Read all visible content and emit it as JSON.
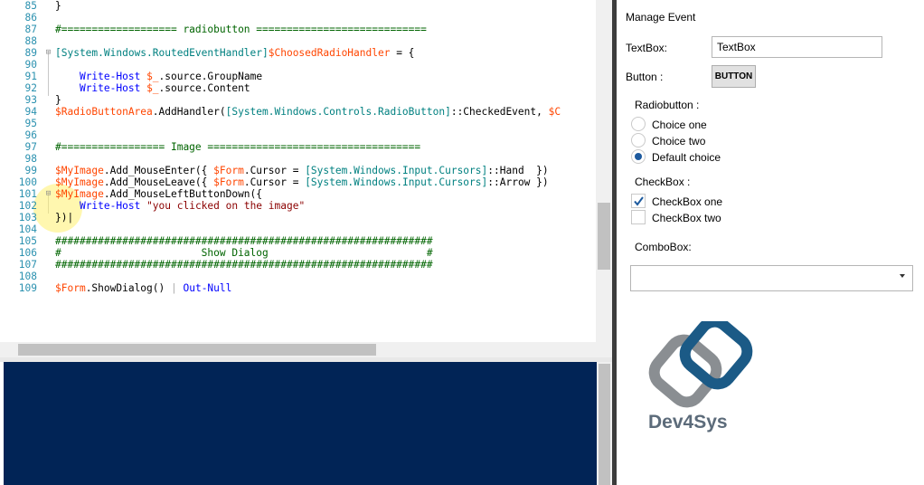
{
  "editor": {
    "lines": [
      {
        "n": "85",
        "parts": [
          [
            "}",
            ""
          ]
        ]
      },
      {
        "n": "86",
        "parts": []
      },
      {
        "n": "87",
        "parts": [
          [
            "#=================== radiobutton ============================",
            "c-cm"
          ]
        ]
      },
      {
        "n": "88",
        "parts": []
      },
      {
        "n": "89",
        "fold": "⊟",
        "parts": [
          [
            "[System.Windows.RoutedEventHandler]",
            "c-type"
          ],
          [
            "$ChoosedRadioHandler",
            "c-var"
          ],
          [
            " = {",
            ""
          ]
        ]
      },
      {
        "n": "90",
        "parts": []
      },
      {
        "n": "91",
        "parts": [
          [
            "    ",
            ""
          ],
          [
            "Write-Host",
            "c-cmd"
          ],
          [
            " ",
            ""
          ],
          [
            "$_",
            "c-var"
          ],
          [
            ".source.GroupName",
            ""
          ]
        ]
      },
      {
        "n": "92",
        "parts": [
          [
            "    ",
            ""
          ],
          [
            "Write-Host",
            "c-cmd"
          ],
          [
            " ",
            ""
          ],
          [
            "$_",
            "c-var"
          ],
          [
            ".source.Content",
            ""
          ]
        ]
      },
      {
        "n": "93",
        "parts": [
          [
            "}",
            ""
          ]
        ]
      },
      {
        "n": "94",
        "parts": [
          [
            "$RadioButtonArea",
            "c-var"
          ],
          [
            ".AddHandler(",
            ""
          ],
          [
            "[System.Windows.Controls.RadioButton]",
            "c-type"
          ],
          [
            "::CheckedEvent, ",
            ""
          ],
          [
            "$C",
            "c-var"
          ]
        ]
      },
      {
        "n": "95",
        "parts": []
      },
      {
        "n": "96",
        "parts": []
      },
      {
        "n": "97",
        "parts": [
          [
            "#================= Image ===================================",
            "c-cm"
          ]
        ]
      },
      {
        "n": "98",
        "parts": []
      },
      {
        "n": "99",
        "parts": [
          [
            "$MyImage",
            "c-var"
          ],
          [
            ".Add_MouseEnter({ ",
            ""
          ],
          [
            "$Form",
            "c-var"
          ],
          [
            ".Cursor = ",
            ""
          ],
          [
            "[System.Windows.Input.Cursors]",
            "c-type"
          ],
          [
            "::Hand  })",
            ""
          ]
        ]
      },
      {
        "n": "100",
        "parts": [
          [
            "$MyImage",
            "c-var"
          ],
          [
            ".Add_MouseLeave({ ",
            ""
          ],
          [
            "$Form",
            "c-var"
          ],
          [
            ".Cursor = ",
            ""
          ],
          [
            "[System.Windows.Input.Cursors]",
            "c-type"
          ],
          [
            "::Arrow })",
            ""
          ]
        ]
      },
      {
        "n": "101",
        "fold": "⊟",
        "parts": [
          [
            "$MyImage",
            "c-var"
          ],
          [
            ".Add_MouseLeftButtonDown({",
            ""
          ]
        ]
      },
      {
        "n": "102",
        "parts": [
          [
            "    ",
            ""
          ],
          [
            "Write-Host",
            "c-cmd"
          ],
          [
            " ",
            ""
          ],
          [
            "\"you clicked on the image\"",
            "c-str"
          ]
        ]
      },
      {
        "n": "103",
        "parts": [
          [
            "})|",
            ""
          ]
        ]
      },
      {
        "n": "104",
        "parts": []
      },
      {
        "n": "105",
        "parts": [
          [
            "##############################################################",
            "c-cm"
          ]
        ]
      },
      {
        "n": "106",
        "parts": [
          [
            "#                       Show Dialog                          #",
            "c-cm"
          ]
        ]
      },
      {
        "n": "107",
        "parts": [
          [
            "##############################################################",
            "c-cm"
          ]
        ]
      },
      {
        "n": "108",
        "parts": []
      },
      {
        "n": "109",
        "parts": [
          [
            "$Form",
            "c-var"
          ],
          [
            ".ShowDialog() ",
            ""
          ],
          [
            "|",
            "c-op"
          ],
          [
            " ",
            ""
          ],
          [
            "Out-Null",
            "c-cmd"
          ]
        ]
      }
    ]
  },
  "form": {
    "title": "Manage Event",
    "textbox_label": "TextBox:",
    "textbox_value": "TextBox",
    "button_label": "Button :",
    "button_text": "BUTTON",
    "radio_label": "Radiobutton :",
    "radios": [
      {
        "label": "Choice one",
        "checked": false
      },
      {
        "label": "Choice two",
        "checked": false
      },
      {
        "label": "Default choice",
        "checked": true
      }
    ],
    "checkbox_label": "CheckBox :",
    "checkboxes": [
      {
        "label": "CheckBox one",
        "checked": true
      },
      {
        "label": "CheckBox two",
        "checked": false
      }
    ],
    "combobox_label": "ComboBox:",
    "combobox_value": "",
    "logo_text": "Dev4Sys"
  },
  "colors": {
    "console_bg": "#012456",
    "accent": "#1d5a9e",
    "logo_blue": "#1b5a86",
    "logo_grey": "#8a8e92"
  }
}
